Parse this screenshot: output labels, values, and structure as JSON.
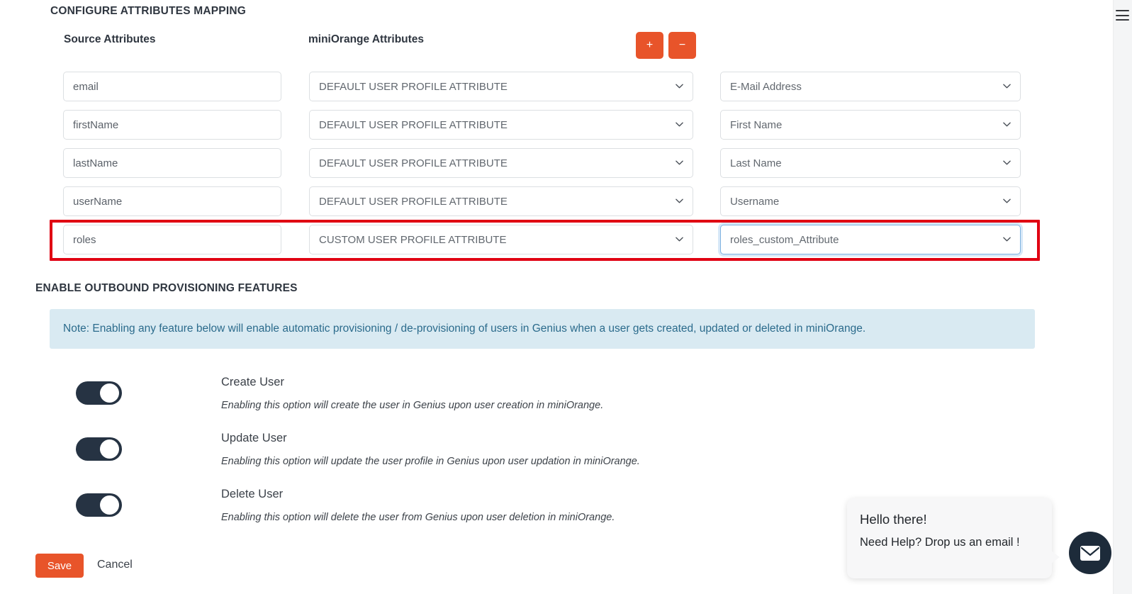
{
  "section_titles": {
    "configure": "CONFIGURE ATTRIBUTES MAPPING",
    "enable": "ENABLE OUTBOUND PROVISIONING FEATURES"
  },
  "column_headers": {
    "source": "Source Attributes",
    "miniorange": "miniOrange Attributes"
  },
  "row_buttons": {
    "add": "+",
    "remove": "−"
  },
  "mapping_rows": [
    {
      "source_value": "email",
      "attribute_type": "DEFAULT USER PROFILE ATTRIBUTE",
      "mapped_attribute": "E-Mail Address",
      "highlighted": false,
      "focused": false
    },
    {
      "source_value": "firstName",
      "attribute_type": "DEFAULT USER PROFILE ATTRIBUTE",
      "mapped_attribute": "First Name",
      "highlighted": false,
      "focused": false
    },
    {
      "source_value": "lastName",
      "attribute_type": "DEFAULT USER PROFILE ATTRIBUTE",
      "mapped_attribute": "Last Name",
      "highlighted": false,
      "focused": false
    },
    {
      "source_value": "userName",
      "attribute_type": "DEFAULT USER PROFILE ATTRIBUTE",
      "mapped_attribute": "Username",
      "highlighted": false,
      "focused": false
    },
    {
      "source_value": "roles",
      "attribute_type": "CUSTOM USER PROFILE ATTRIBUTE",
      "mapped_attribute": "roles_custom_Attribute",
      "highlighted": true,
      "focused": true
    }
  ],
  "note": {
    "text": "Note: Enabling any feature below will enable automatic provisioning / de-provisioning of users in Genius when a user gets created, updated or deleted in miniOrange."
  },
  "features": [
    {
      "label": "Create User",
      "description": "Enabling this option will create the user in Genius upon user creation in miniOrange.",
      "enabled": true
    },
    {
      "label": "Update User",
      "description": "Enabling this option will update the user profile in Genius upon user updation in miniOrange.",
      "enabled": true
    },
    {
      "label": "Delete User",
      "description": "Enabling this option will delete the user from Genius upon user deletion in miniOrange.",
      "enabled": true
    }
  ],
  "actions": {
    "save": "Save",
    "cancel": "Cancel"
  },
  "chat": {
    "greeting": "Hello there!",
    "prompt": "Need Help? Drop us an email !",
    "icon": "envelope-icon"
  },
  "icons": {
    "menu": "hamburger-icon",
    "caret": "chevron-down-icon"
  },
  "colors": {
    "accent_orange": "#e8542a",
    "highlight_red": "#e00012",
    "note_bg": "#d9eaf2",
    "note_text": "#2b6b8c",
    "toggle_on": "#263343",
    "chat_fab": "#1d2b3a"
  }
}
